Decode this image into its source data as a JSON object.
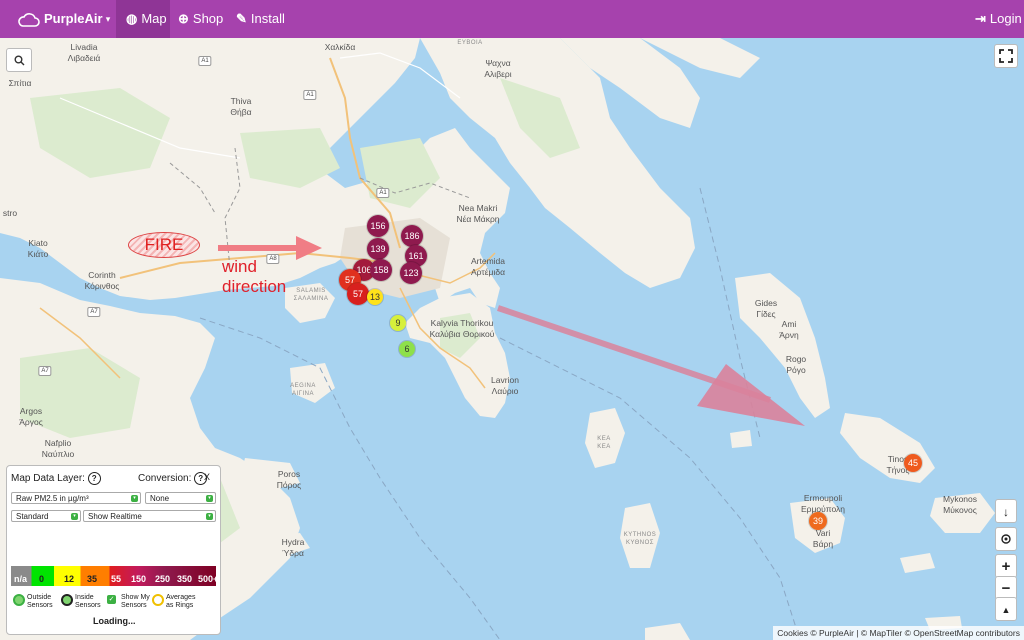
{
  "nav": {
    "brand": "PurpleAir",
    "caret": "▾",
    "map": "Map",
    "shop": "Shop",
    "install": "Install",
    "login": "Login"
  },
  "colors": {
    "nav_bg": "#a642ad",
    "water": "#a8d3f0",
    "land": "#f4f1ea",
    "aqi_bad_red": "#c8102e",
    "aqi_very_bad": "#8f1a4e"
  },
  "icons": {
    "brand": "cloud-icon",
    "map": "globe-icon",
    "shop": "plus-circle-icon",
    "install": "wrench-icon",
    "login": "sign-in-icon",
    "search": "search-icon",
    "fullscreen": "fullscreen-icon",
    "download": "download-icon",
    "locate": "locate-icon",
    "zoom_in": "plus-icon",
    "zoom_out": "minus-icon",
    "north": "north-arrow-icon"
  },
  "map": {
    "places": [
      {
        "name": "Χαλκίδα"
      },
      {
        "name": "ΕΥΒΟΙΑ"
      },
      {
        "name": "Livadia"
      },
      {
        "name": "Λιβαδειά"
      },
      {
        "name": "Ψαχνα"
      },
      {
        "name": "Αλιβερι"
      },
      {
        "name": "Thiva"
      },
      {
        "name": "Θήβα"
      },
      {
        "name": "Nea Makri"
      },
      {
        "name": "Νέα Μάκρη"
      },
      {
        "name": "Kiato"
      },
      {
        "name": "Κιάτο"
      },
      {
        "name": "Corinth"
      },
      {
        "name": "Κόρινθος"
      },
      {
        "name": "Artemida"
      },
      {
        "name": "Αρτέμιδα"
      },
      {
        "name": "SALAMIS"
      },
      {
        "name": "ΣΑΛΑΜΙΝΑ"
      },
      {
        "name": "Kalyvia Thorikou"
      },
      {
        "name": "Καλύβια Θορικού"
      },
      {
        "name": "Lavrion"
      },
      {
        "name": "Λαύριο"
      },
      {
        "name": "AEGINA"
      },
      {
        "name": "ΑΙΓΙΝΑ"
      },
      {
        "name": "Argos"
      },
      {
        "name": "Άργος"
      },
      {
        "name": "Nafplio"
      },
      {
        "name": "Ναύπλιο"
      },
      {
        "name": "Poros"
      },
      {
        "name": "Πόρος"
      },
      {
        "name": "Hydra"
      },
      {
        "name": "Ύδρα"
      },
      {
        "name": "KEA"
      },
      {
        "name": "ΚΕΑ"
      },
      {
        "name": "KYTHNOS"
      },
      {
        "name": "ΚΥΘΝΟΣ"
      },
      {
        "name": "Gides"
      },
      {
        "name": "Γίδες"
      },
      {
        "name": "Ami"
      },
      {
        "name": "Άρνη"
      },
      {
        "name": "Rogo"
      },
      {
        "name": "Ρόγο"
      },
      {
        "name": "Tinos"
      },
      {
        "name": "Τήνος"
      },
      {
        "name": "Ermoupoli"
      },
      {
        "name": "Ερμούπολη"
      },
      {
        "name": "Vari"
      },
      {
        "name": "Βάρη"
      },
      {
        "name": "Mykonos"
      },
      {
        "name": "Μύκονος"
      },
      {
        "name": "Σπίτια"
      },
      {
        "name": "stro"
      }
    ],
    "highways": [
      "A1",
      "A1",
      "A1",
      "A7",
      "A7",
      "A8"
    ],
    "sensors": [
      {
        "value": "156"
      },
      {
        "value": "186"
      },
      {
        "value": "139"
      },
      {
        "value": "161"
      },
      {
        "value": "106"
      },
      {
        "value": "158"
      },
      {
        "value": "123"
      },
      {
        "value": "57"
      },
      {
        "value": "57"
      },
      {
        "value": "13"
      },
      {
        "value": "9"
      },
      {
        "value": "6"
      },
      {
        "value": "45"
      },
      {
        "value": "39"
      }
    ],
    "annotations": {
      "fire": "FIRE",
      "wind_line1": "wind",
      "wind_line2": "direction"
    },
    "buttons": {
      "zoom_in": "+",
      "zoom_out": "−",
      "north": "▲",
      "download": "↓"
    }
  },
  "panel": {
    "title": "Map Data Layer:",
    "help": "?",
    "conversion_label": "Conversion:",
    "close": "X",
    "layer_select": "Raw PM2.5 in µg/m³",
    "conversion_select": "None",
    "style_select": "Standard",
    "time_select": "Show Realtime",
    "legend_ticks": [
      "n/a",
      "0",
      "12",
      "35",
      "55",
      "150",
      "250",
      "350",
      "500+"
    ],
    "options": [
      {
        "label_1": "Outside",
        "label_2": "Sensors"
      },
      {
        "label_1": "Inside",
        "label_2": "Sensors"
      },
      {
        "label_1": "Show My",
        "label_2": "Sensors"
      },
      {
        "label_1": "Averages",
        "label_2": "as Rings"
      }
    ],
    "status": "Loading..."
  },
  "attribution": "Cookies © PurpleAir | © MapTiler © OpenStreetMap contributors"
}
